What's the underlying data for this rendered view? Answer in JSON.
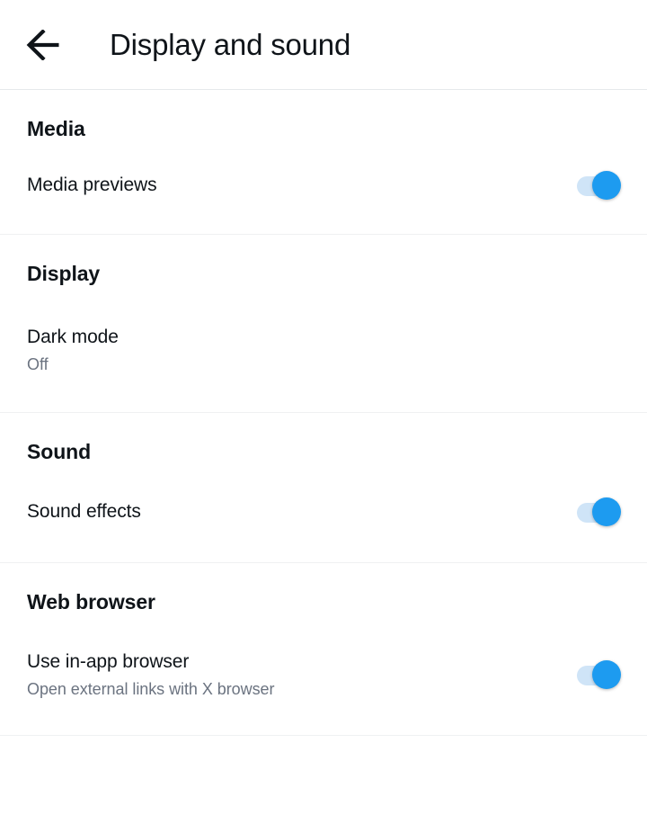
{
  "header": {
    "back_icon": "arrow-left-icon",
    "title": "Display and sound"
  },
  "colors": {
    "accent": "#1d9bf0",
    "toggle_track_on": "#cfe4f7",
    "text_primary": "#0f1419",
    "text_secondary": "#6b7380",
    "divider": "#eff1f2",
    "background": "#ffffff"
  },
  "sections": [
    {
      "title": "Media",
      "rows": [
        {
          "label": "Media previews",
          "subtitle": "",
          "control": "toggle",
          "state": "on"
        }
      ]
    },
    {
      "title": "Display",
      "rows": [
        {
          "label": "Dark mode",
          "subtitle": "Off",
          "control": "none",
          "state": ""
        }
      ]
    },
    {
      "title": "Sound",
      "rows": [
        {
          "label": "Sound effects",
          "subtitle": "",
          "control": "toggle",
          "state": "on"
        }
      ]
    },
    {
      "title": "Web browser",
      "rows": [
        {
          "label": "Use in-app browser",
          "subtitle": "Open external links with X browser",
          "control": "toggle",
          "state": "on"
        }
      ]
    }
  ]
}
